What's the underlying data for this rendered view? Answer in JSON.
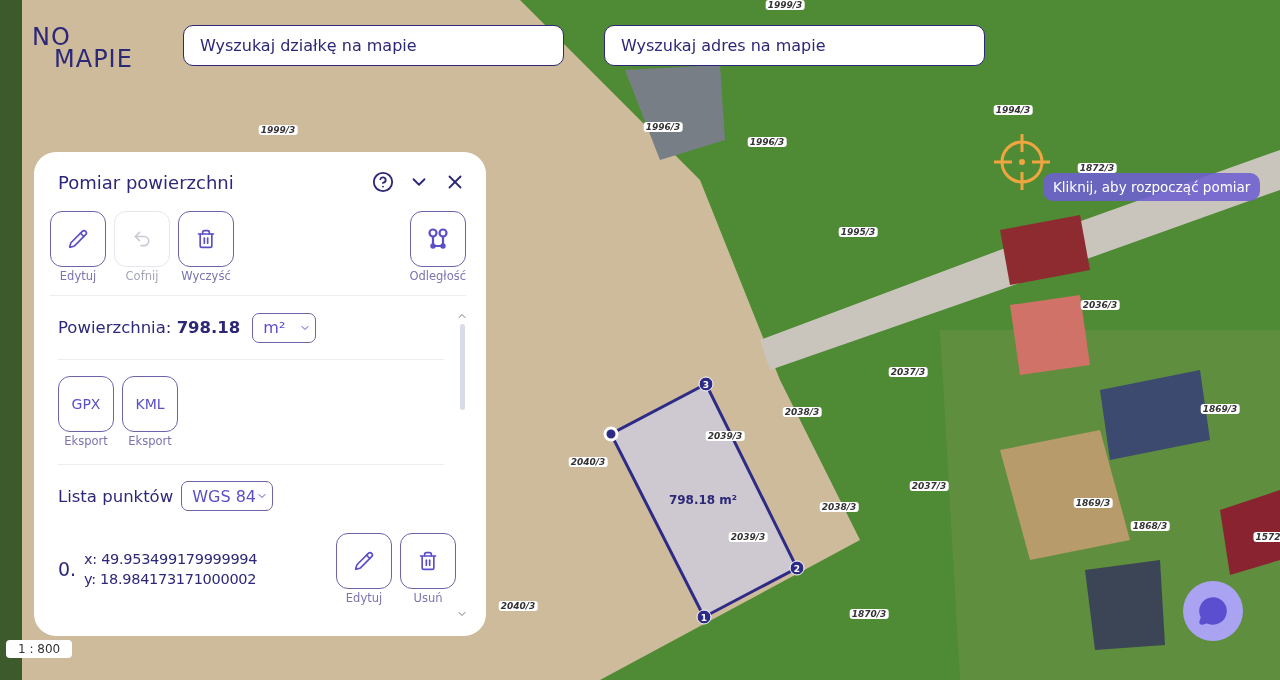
{
  "logo": {
    "line_1": "NO",
    "line_2": "MAPIE"
  },
  "search_fields": [
    {
      "placeholder": "Wyszukaj działkę na mapie"
    },
    {
      "placeholder": "Wyszukaj adres na mapie"
    }
  ],
  "map": {
    "parcel_labels": [
      "1999/3",
      "1999/3",
      "1996/3",
      "1996/3",
      "1994/3",
      "1872/3",
      "1995/3",
      "2036/3",
      "2037/3",
      "2037/3",
      "2038/3",
      "2038/3",
      "2039/3",
      "2039/3",
      "2040/3",
      "2040/3",
      "1870/3",
      "1869/3",
      "1869/3",
      "1868/3",
      "1572"
    ],
    "polygon": {
      "area_label": "798.18 m²",
      "vertices": [
        {
          "kind": "numbered",
          "label": "1"
        },
        {
          "kind": "numbered",
          "label": "2"
        },
        {
          "kind": "numbered",
          "label": "3"
        },
        {
          "kind": "start"
        }
      ]
    },
    "tooltip": "Kliknij, aby rozpocząć pomiar",
    "scale": "1 : 800"
  },
  "panel": {
    "title": "Pomiar powierzchni",
    "tools": [
      {
        "kind": "edit",
        "label": "Edytuj",
        "disabled": false
      },
      {
        "kind": "undo",
        "label": "Cofnij",
        "disabled": true
      },
      {
        "kind": "clear",
        "label": "Wyczyść",
        "disabled": false
      },
      {
        "kind": "distance",
        "label": "Odległość",
        "disabled": false
      }
    ],
    "area": {
      "label": "Powierzchnia:",
      "value": "798.18",
      "unit": "m²"
    },
    "exports": [
      {
        "format": "GPX",
        "label": "Eksport"
      },
      {
        "format": "KML",
        "label": "Eksport"
      }
    ],
    "points": {
      "label": "Lista punktów",
      "crs": "WGS 84",
      "items": [
        {
          "index": "0.",
          "x": "x: 49.953499179999994",
          "y": "y: 18.984173171000002",
          "actions": [
            {
              "kind": "edit",
              "label": "Edytuj"
            },
            {
              "kind": "delete",
              "label": "Usuń"
            }
          ]
        }
      ]
    }
  }
}
